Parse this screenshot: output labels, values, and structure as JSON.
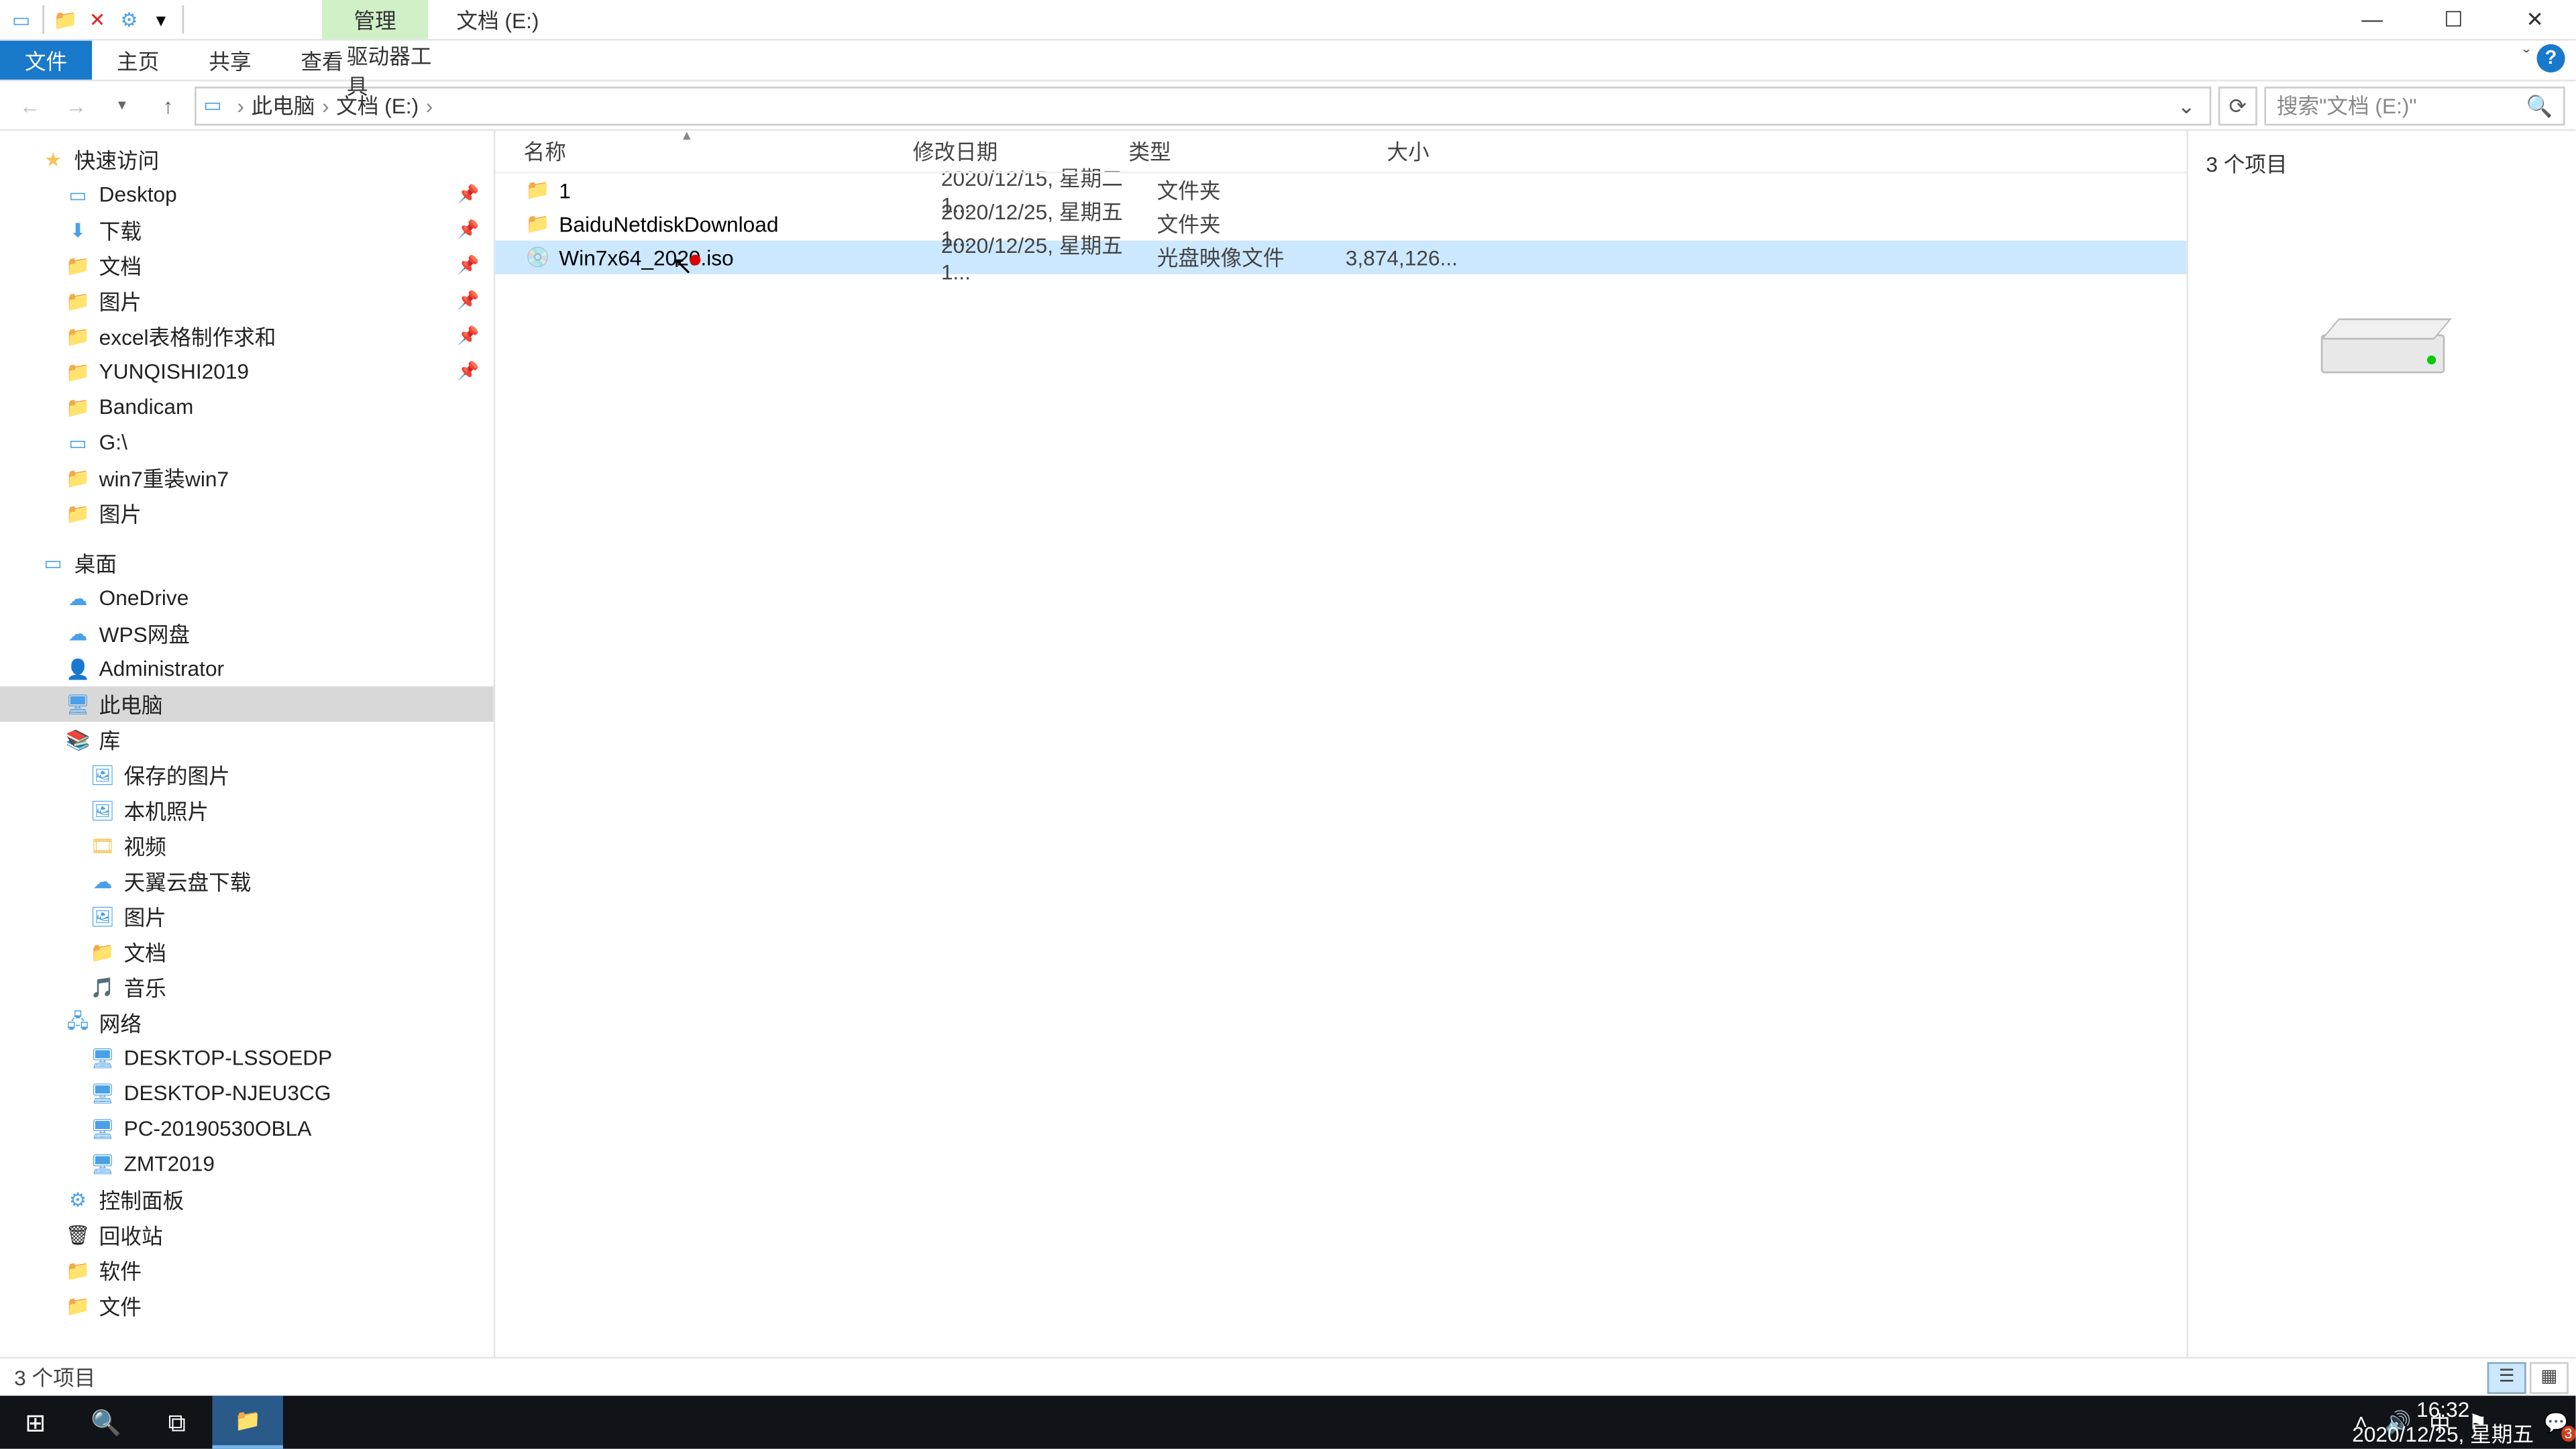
{
  "titlebar": {
    "manage_tab": "管理",
    "title": "文档 (E:)"
  },
  "ribbon": {
    "file": "文件",
    "home": "主页",
    "share": "共享",
    "view": "查看",
    "drive_tools": "驱动器工具"
  },
  "address": {
    "seg1": "此电脑",
    "seg2": "文档 (E:)",
    "search_placeholder": "搜索\"文档 (E:)\""
  },
  "nav_tree": {
    "quick_access": "快速访问",
    "desktop": "Desktop",
    "downloads": "下载",
    "documents": "文档",
    "pictures": "图片",
    "excel": "excel表格制作求和",
    "yunqishi": "YUNQISHI2019",
    "bandicam": "Bandicam",
    "gdrive": "G:\\",
    "win7reinstall": "win7重装win7",
    "pictures2": "图片",
    "desktop_cn": "桌面",
    "onedrive": "OneDrive",
    "wps": "WPS网盘",
    "admin": "Administrator",
    "thispc": "此电脑",
    "library": "库",
    "saved_pics": "保存的图片",
    "local_photos": "本机照片",
    "videos": "视频",
    "tianyi": "天翼云盘下载",
    "pics3": "图片",
    "docs2": "文档",
    "music": "音乐",
    "network": "网络",
    "net1": "DESKTOP-LSSOEDP",
    "net2": "DESKTOP-NJEU3CG",
    "net3": "PC-20190530OBLA",
    "net4": "ZMT2019",
    "control_panel": "控制面板",
    "recycle": "回收站",
    "software": "软件",
    "files": "文件"
  },
  "columns": {
    "name": "名称",
    "date": "修改日期",
    "type": "类型",
    "size": "大小"
  },
  "rows": [
    {
      "icon": "folder",
      "name": "1",
      "date": "2020/12/15, 星期二 1...",
      "type": "文件夹",
      "size": ""
    },
    {
      "icon": "folder",
      "name": "BaiduNetdiskDownload",
      "date": "2020/12/25, 星期五 1...",
      "type": "文件夹",
      "size": ""
    },
    {
      "icon": "disc",
      "name": "Win7x64_2020.iso",
      "date": "2020/12/25, 星期五 1...",
      "type": "光盘映像文件",
      "size": "3,874,126..."
    }
  ],
  "preview": {
    "count_text": "3 个项目"
  },
  "status": {
    "text": "3 个项目"
  },
  "taskbar": {
    "time": "16:32",
    "date": "2020/12/25, 星期五",
    "ime": "中",
    "notif_count": "3"
  }
}
